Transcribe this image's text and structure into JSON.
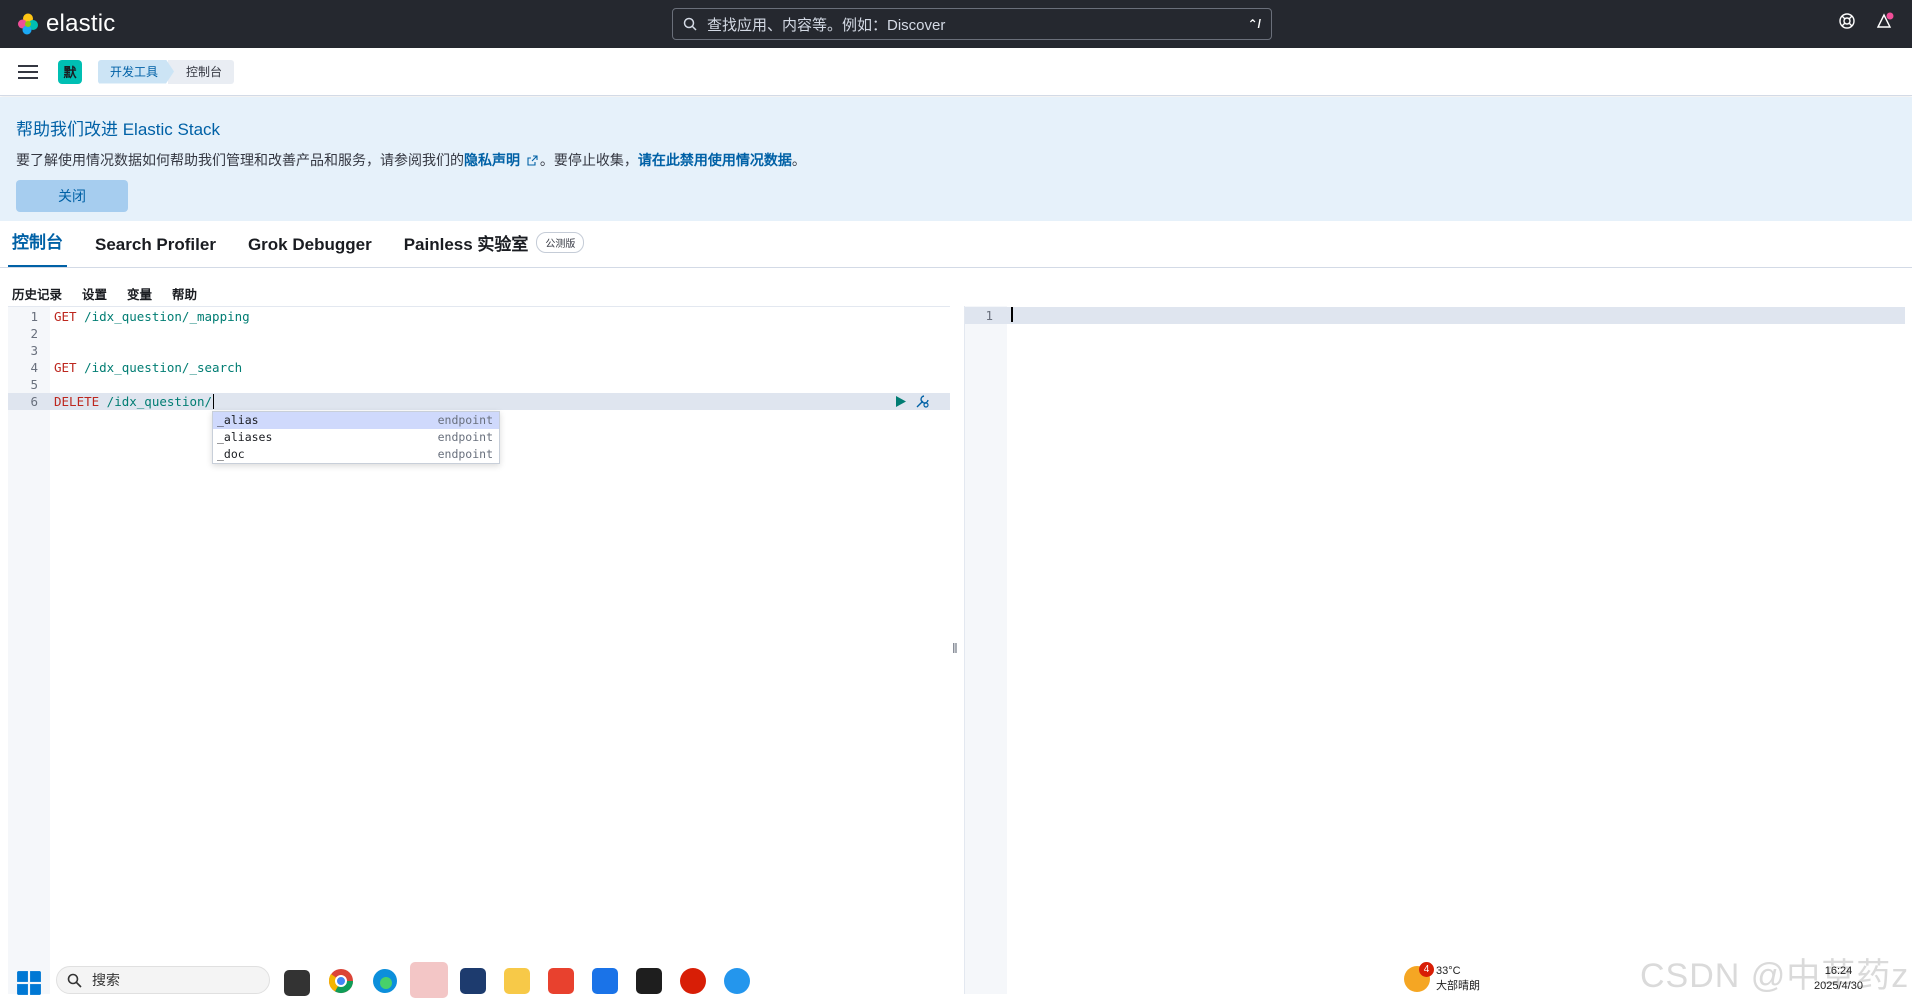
{
  "app": {
    "logo_text": "elastic"
  },
  "search": {
    "placeholder": "查找应用、内容等。例如：Discover",
    "shortcut": "⌃/"
  },
  "header": {
    "space_initial": "默",
    "breadcrumbs": [
      "开发工具",
      "控制台"
    ]
  },
  "callout": {
    "title": "帮助我们改进 Elastic Stack",
    "body_prefix": "要了解使用情况数据如何帮助我们管理和改善产品和服务，请参阅我们的",
    "privacy_link": "隐私声明",
    "body_middle": "。要停止收集，",
    "disable_link": "请在此禁用使用情况数据",
    "body_suffix": "。",
    "close_label": "关闭"
  },
  "tabs": [
    {
      "label": "控制台",
      "active": true
    },
    {
      "label": "Search Profiler"
    },
    {
      "label": "Grok Debugger"
    },
    {
      "label": "Painless 实验室",
      "badge": "公测版"
    }
  ],
  "menu": [
    "历史记录",
    "设置",
    "变量",
    "帮助"
  ],
  "editor": {
    "lines": [
      {
        "num": "1",
        "method": "GET",
        "path": " /idx_question/_mapping"
      },
      {
        "num": "2",
        "method": "",
        "path": ""
      },
      {
        "num": "3",
        "method": "",
        "path": ""
      },
      {
        "num": "4",
        "method": "GET",
        "path": " /idx_question/_search"
      },
      {
        "num": "5",
        "method": "",
        "path": ""
      },
      {
        "num": "6",
        "method": "DELETE",
        "path": " /idx_question/"
      }
    ],
    "autocomplete": [
      {
        "value": "_alias",
        "type": "endpoint"
      },
      {
        "value": "_aliases",
        "type": "endpoint"
      },
      {
        "value": "_doc",
        "type": "endpoint"
      }
    ]
  },
  "output": {
    "line_num": "1"
  },
  "taskbar": {
    "search_label": "搜索",
    "weather_temp": "33°C",
    "weather_desc": "大部晴朗",
    "weather_badge": "4",
    "time": "16:24",
    "date": "2025/4/30"
  },
  "watermark": "CSDN @中草药z",
  "colors": {
    "accent": "#0061a6",
    "topbar": "#25282f",
    "callout_bg": "#e6f1fa",
    "method": "#bd271e",
    "path": "#017d73"
  }
}
